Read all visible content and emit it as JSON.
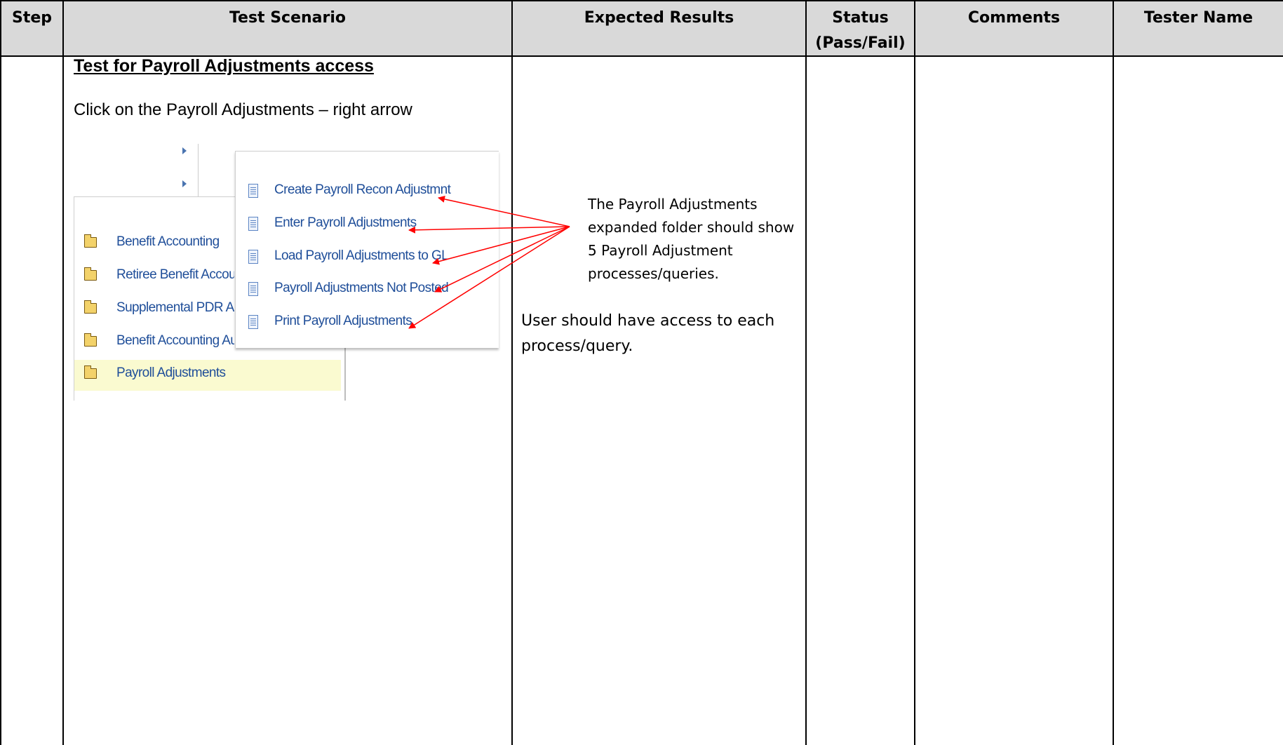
{
  "table": {
    "headers": [
      {
        "label": "Step"
      },
      {
        "label": "Test Scenario"
      },
      {
        "label": "Expected Results"
      },
      {
        "label": "Status",
        "label2": "(Pass/Fail)"
      },
      {
        "label": "Comments"
      },
      {
        "label": "Tester Name"
      }
    ]
  },
  "scenario": {
    "title": "Test for Payroll Adjustments access",
    "instruction": "Click on the Payroll Adjustments – right arrow"
  },
  "screenshot": {
    "menu_items": [
      {
        "label": "Benefit Accounting",
        "icon": "folder-icon",
        "selected": false
      },
      {
        "label": "Retiree Benefit Accounting",
        "icon": "folder-icon",
        "selected": false
      },
      {
        "label": "Supplemental PDR Accounting",
        "icon": "folder-icon",
        "selected": false
      },
      {
        "label": "Benefit Accounting Audit",
        "icon": "folder-icon",
        "selected": false
      },
      {
        "label": "Payroll Adjustments",
        "icon": "folder-icon",
        "selected": true
      }
    ],
    "popup_items": [
      {
        "label": "Create Payroll Recon Adjustmnt",
        "icon": "document-icon"
      },
      {
        "label": "Enter Payroll Adjustments",
        "icon": "document-icon"
      },
      {
        "label": "Load Payroll Adjustments to GL",
        "icon": "document-icon"
      },
      {
        "label": "Payroll Adjustments Not Posted",
        "icon": "document-icon"
      },
      {
        "label": "Print Payroll Adjustments",
        "icon": "document-icon"
      }
    ]
  },
  "expected": {
    "note": "The Payroll Adjustments expanded folder should show 5 Payroll Adjustment processes/queries.",
    "access": "User should have access to each process/query."
  },
  "colors": {
    "header_bg": "#d9d9d9",
    "link_blue": "#1f4e99",
    "selected_row": "#fafad0",
    "annotation_arrow": "#ff0000"
  }
}
